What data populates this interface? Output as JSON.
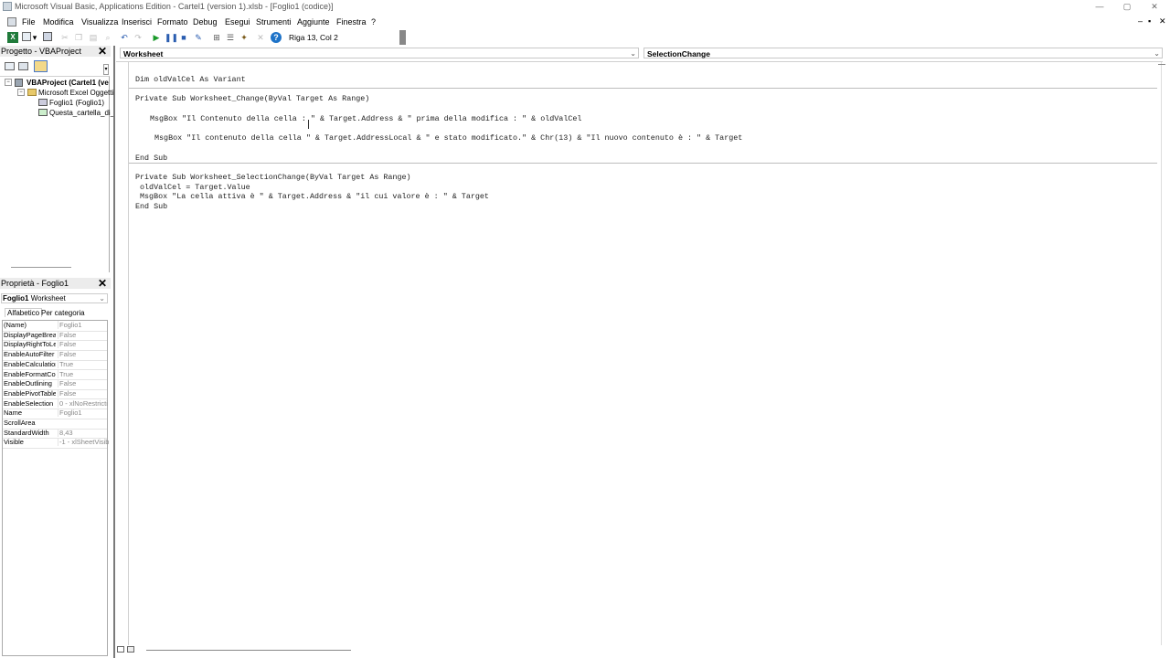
{
  "window": {
    "title": "Microsoft Visual Basic, Applications Edition - Cartel1 (version 1).xlsb - [Foglio1 (codice)]",
    "controls": [
      "—",
      "▢",
      "✕"
    ],
    "mdi_controls": [
      "–",
      "▪",
      "✕"
    ]
  },
  "menu": {
    "items": [
      "File",
      "Modifica",
      "Visualizza",
      "Inserisci",
      "Formato",
      "Debug",
      "Esegui",
      "Strumenti",
      "Aggiunte",
      "Finestra",
      "?"
    ]
  },
  "toolbar": {
    "position_status": "Riga 13, Col 2"
  },
  "project": {
    "title": "Progetto - VBAProject",
    "root": "VBAProject (Cartel1 (ve",
    "folder": "Microsoft Excel Oggetti",
    "sheet": "Foglio1 (Foglio1)",
    "workbook": "Questa_cartella_di_"
  },
  "properties": {
    "title": "Proprietà - Foglio1",
    "object_name": "Foglio1",
    "object_type": "Worksheet",
    "tabs": [
      "Alfabetico",
      "Per categoria"
    ],
    "rows": [
      {
        "name": "(Name)",
        "value": "Foglio1"
      },
      {
        "name": "DisplayPageBreak",
        "value": "False"
      },
      {
        "name": "DisplayRightToLef",
        "value": "False"
      },
      {
        "name": "EnableAutoFilter",
        "value": "False"
      },
      {
        "name": "EnableCalculation",
        "value": "True"
      },
      {
        "name": "EnableFormatCon",
        "value": "True"
      },
      {
        "name": "EnableOutlining",
        "value": "False"
      },
      {
        "name": "EnablePivotTable",
        "value": "False"
      },
      {
        "name": "EnableSelection",
        "value": "0 - xlNoRestricti"
      },
      {
        "name": "Name",
        "value": "Foglio1"
      },
      {
        "name": "ScrollArea",
        "value": ""
      },
      {
        "name": "StandardWidth",
        "value": "8,43"
      },
      {
        "name": "Visible",
        "value": "-1 - xlSheetVisib"
      }
    ]
  },
  "editor": {
    "object_combo": "Worksheet",
    "procedure_combo": "SelectionChange",
    "lines": {
      "l1": "Dim oldValCel As Variant",
      "l2": "Private Sub Worksheet_Change(ByVal Target As Range)",
      "l3": "MsgBox \"Il Contenuto della cella : \" & Target.Address & \" prima della modifica : \" & oldValCel",
      "l4": "MsgBox \"Il contenuto della cella \" & Target.AddressLocal & \" e stato modificato.\" & Chr(13) & \"Il nuovo contenuto è : \" & Target",
      "l5": "End Sub",
      "l6": "Private Sub Worksheet_SelectionChange(ByVal Target As Range)",
      "l7": "oldValCel = Target.Value",
      "l8": "MsgBox \"La cella attiva è \" & Target.Address & \"il cui valore è : \" & Target",
      "l9": "End Sub"
    }
  }
}
